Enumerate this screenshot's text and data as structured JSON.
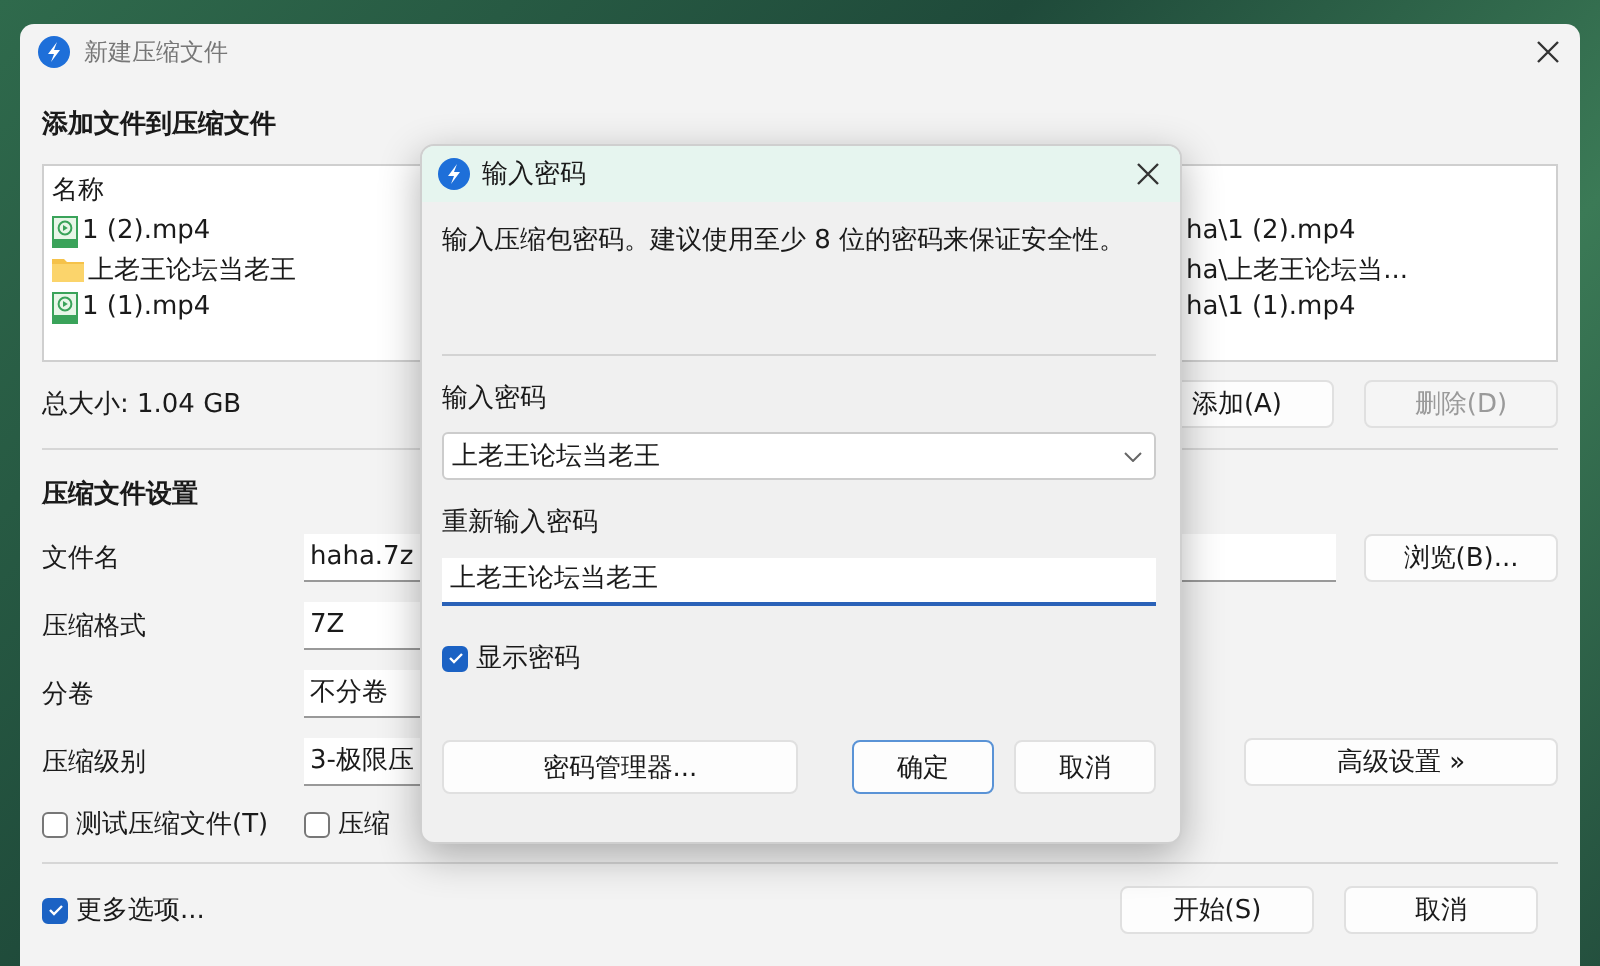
{
  "window": {
    "title": "新建压缩文件"
  },
  "files_section": {
    "heading": "添加文件到压缩文件",
    "column_name": "名称",
    "files": [
      {
        "kind": "video",
        "name": "1 (2).mp4",
        "path": "ha\\1 (2).mp4"
      },
      {
        "kind": "folder",
        "name": "上老王论坛当老王",
        "path": "ha\\上老王论坛当..."
      },
      {
        "kind": "video",
        "name": "1 (1).mp4",
        "path": "ha\\1 (1).mp4"
      }
    ],
    "total_size": "总大小: 1.04 GB",
    "buttons": [
      {
        "label": "添加(A)",
        "disabled": false
      },
      {
        "label": "删除(D)",
        "disabled": true
      }
    ]
  },
  "settings": {
    "heading": "压缩文件设置",
    "rows": [
      {
        "label": "文件名",
        "value": "haha.7z",
        "kind": "text"
      },
      {
        "label": "压缩格式",
        "value": "7Z",
        "kind": "select"
      },
      {
        "label": "分卷",
        "value": "不分卷",
        "kind": "select"
      },
      {
        "label": "压缩级别",
        "value": "3-极限压",
        "kind": "select"
      }
    ],
    "browse_button": "浏览(B)...",
    "advanced_button": "高级设置 »",
    "options": [
      {
        "label": "测试压缩文件(T)",
        "checked": false
      },
      {
        "label": "压缩",
        "checked": false
      }
    ]
  },
  "footer": {
    "more_options": {
      "label": "更多选项...",
      "checked": true
    },
    "buttons": [
      "开始(S)",
      "取消"
    ]
  },
  "dialog": {
    "title": "输入密码",
    "message": "输入压缩包密码。建议使用至少 8 位的密码来保证安全性。",
    "password_label": "输入密码",
    "password": "上老王论坛当老王",
    "confirm_label": "重新输入密码",
    "confirm": "上老王论坛当老王",
    "show_password": {
      "label": "显示密码",
      "checked": true
    },
    "manager_button": "密码管理器...",
    "buttons": [
      {
        "label": "确定",
        "default": true
      },
      {
        "label": "取消",
        "default": false
      }
    ]
  }
}
